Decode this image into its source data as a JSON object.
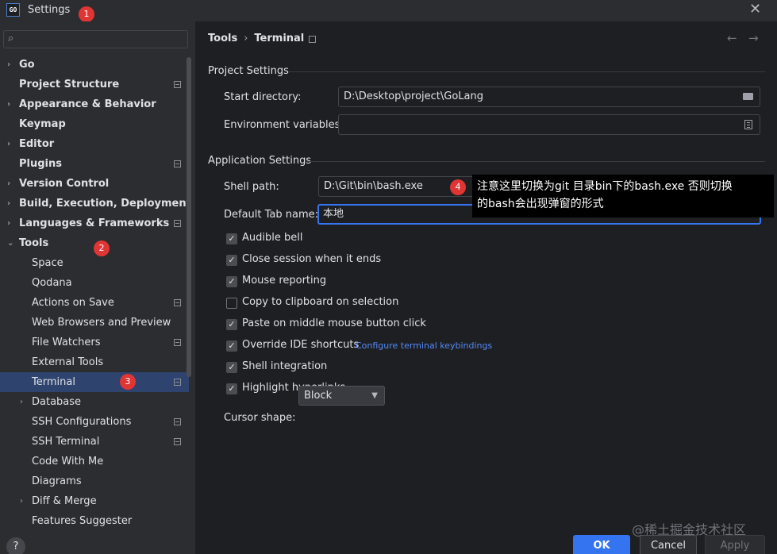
{
  "window": {
    "title": "Settings",
    "app_icon_text": "GO"
  },
  "badges": [
    "1",
    "2",
    "3",
    "4"
  ],
  "sidebar": {
    "search_placeholder": "",
    "items": [
      {
        "label": "Go",
        "chevron": "›",
        "bold": true
      },
      {
        "label": "Project Structure",
        "bold": true
      },
      {
        "label": "Appearance & Behavior",
        "chevron": "›",
        "bold": true
      },
      {
        "label": "Keymap",
        "bold": true
      },
      {
        "label": "Editor",
        "chevron": "›",
        "bold": true
      },
      {
        "label": "Plugins",
        "bold": true
      },
      {
        "label": "Version Control",
        "chevron": "›",
        "bold": true
      },
      {
        "label": "Build, Execution, Deployment",
        "chevron": "›",
        "bold": true
      },
      {
        "label": "Languages & Frameworks",
        "chevron": "›",
        "bold": true
      },
      {
        "label": "Tools",
        "chevron": "⌄",
        "bold": true
      },
      {
        "label": "Space"
      },
      {
        "label": "Qodana"
      },
      {
        "label": "Actions on Save"
      },
      {
        "label": "Web Browsers and Preview"
      },
      {
        "label": "File Watchers"
      },
      {
        "label": "External Tools"
      },
      {
        "label": "Terminal",
        "selected": true
      },
      {
        "label": "Database",
        "chevron": "›"
      },
      {
        "label": "SSH Configurations"
      },
      {
        "label": "SSH Terminal"
      },
      {
        "label": "Code With Me"
      },
      {
        "label": "Diagrams"
      },
      {
        "label": "Diff & Merge",
        "chevron": "›"
      },
      {
        "label": "Features Suggester"
      }
    ],
    "help_label": "?"
  },
  "breadcrumb": {
    "parent": "Tools",
    "separator": "›",
    "current": "Terminal"
  },
  "project_settings": {
    "title": "Project Settings",
    "start_directory_label": "Start directory:",
    "start_directory_value": "D:\\Desktop\\project\\GoLang",
    "env_vars_label": "Environment variables:",
    "env_vars_value": ""
  },
  "application_settings": {
    "title": "Application Settings",
    "shell_path_label": "Shell path:",
    "shell_path_value": "D:\\Git\\bin\\bash.exe",
    "default_tab_label": "Default Tab name:",
    "default_tab_value": "本地",
    "checkboxes": [
      {
        "label": "Audible bell",
        "checked": true
      },
      {
        "label": "Close session when it ends",
        "checked": true
      },
      {
        "label": "Mouse reporting",
        "checked": true
      },
      {
        "label": "Copy to clipboard on selection",
        "checked": false
      },
      {
        "label": "Paste on middle mouse button click",
        "checked": true
      },
      {
        "label": "Override IDE shortcuts",
        "checked": true
      },
      {
        "label": "Shell integration",
        "checked": true
      },
      {
        "label": "Highlight hyperlinks",
        "checked": true
      }
    ],
    "configure_link": "Configure terminal keybindings",
    "cursor_shape_label": "Cursor shape:",
    "cursor_shape_value": "Block"
  },
  "annotation": {
    "line1": "注意这里切换为git 目录bin下的bash.exe 否则切换",
    "line2": "的bash会出现弹窗的形式"
  },
  "footer": {
    "ok": "OK",
    "cancel": "Cancel",
    "apply": "Apply"
  },
  "watermark": "@稀土掘金技术社区"
}
